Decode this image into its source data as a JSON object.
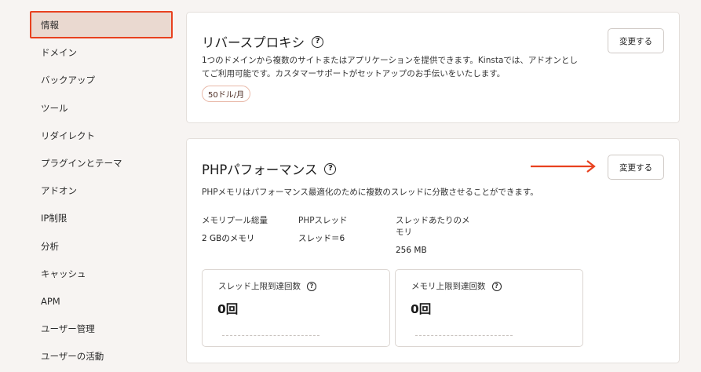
{
  "sidebar": {
    "items": [
      {
        "label": "情報",
        "active": true
      },
      {
        "label": "ドメイン"
      },
      {
        "label": "バックアップ"
      },
      {
        "label": "ツール"
      },
      {
        "label": "リダイレクト"
      },
      {
        "label": "プラグインとテーマ"
      },
      {
        "label": "アドオン"
      },
      {
        "label": "IP制限"
      },
      {
        "label": "分析"
      },
      {
        "label": "キャッシュ"
      },
      {
        "label": "APM"
      },
      {
        "label": "ユーザー管理"
      },
      {
        "label": "ユーザーの活動"
      }
    ]
  },
  "reverse_proxy": {
    "title": "リバースプロキシ",
    "help_icon": "?",
    "change_label": "変更する",
    "description_line1": "1つのドメインから複数のサイトまたはアプリケーションを提供できます。Kinstaでは、アドオンとし",
    "description_line2": "てご利用可能です。カスタマーサポートがセットアップのお手伝いをいたします。",
    "price": "50ドル/月"
  },
  "php_performance": {
    "title": "PHPパフォーマンス",
    "help_icon": "?",
    "change_label": "変更する",
    "description": "PHPメモリはパフォーマンス最適化のために複数のスレッドに分散させることができます。",
    "stats": {
      "memory_pool_label": "メモリプール総量",
      "memory_pool_value": "2 GBのメモリ",
      "threads_label": "PHPスレッド",
      "threads_value": "スレッド＝6",
      "per_thread_label_line1": "スレッドあたりのメ",
      "per_thread_label_line2": "モリ",
      "per_thread_value": "256 MB"
    },
    "metrics": [
      {
        "label": "スレッド上限到達回数",
        "value": "0回"
      },
      {
        "label": "メモリ上限到達回数",
        "value": "0回"
      }
    ]
  },
  "colors": {
    "accent": "#e8411f",
    "active_bg": "#ead9d0",
    "page_bg": "#f7f4f2"
  }
}
